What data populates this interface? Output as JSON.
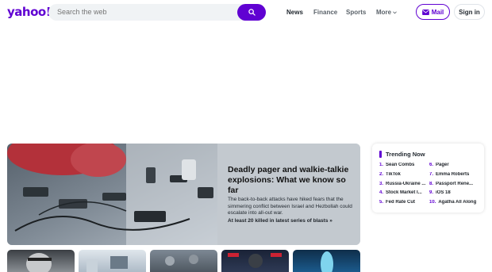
{
  "header": {
    "logo": "yahoo!",
    "search_placeholder": "Search the web",
    "nav": [
      "News",
      "Finance",
      "Sports",
      "More"
    ],
    "mail_label": "Mail",
    "signin_label": "Sign in"
  },
  "hero": {
    "title": "Deadly pager and walkie-talkie explosions: What we know so far",
    "description": "The back-to-back attacks have hiked fears that the simmering conflict between Israel and Hezbollah could escalate into all-out war.",
    "link": "At least 20 killed in latest series of blasts »"
  },
  "trending": {
    "title": "Trending Now",
    "items": [
      {
        "num": "1.",
        "label": "Sean Combs"
      },
      {
        "num": "2.",
        "label": "TikTok"
      },
      {
        "num": "3.",
        "label": "Russia-Ukraine ..."
      },
      {
        "num": "4.",
        "label": "Stock Market I..."
      },
      {
        "num": "5.",
        "label": "Fed Rate Cut"
      },
      {
        "num": "6.",
        "label": "Pager"
      },
      {
        "num": "7.",
        "label": "Emma Roberts"
      },
      {
        "num": "8.",
        "label": "Passport Rene..."
      },
      {
        "num": "9.",
        "label": "iOS 18"
      },
      {
        "num": "10.",
        "label": "Agatha All Along"
      }
    ]
  },
  "colors": {
    "brand": "#6001d2",
    "search_bg": "#f0f3f5",
    "hero_panel": "#c3c9cf"
  }
}
